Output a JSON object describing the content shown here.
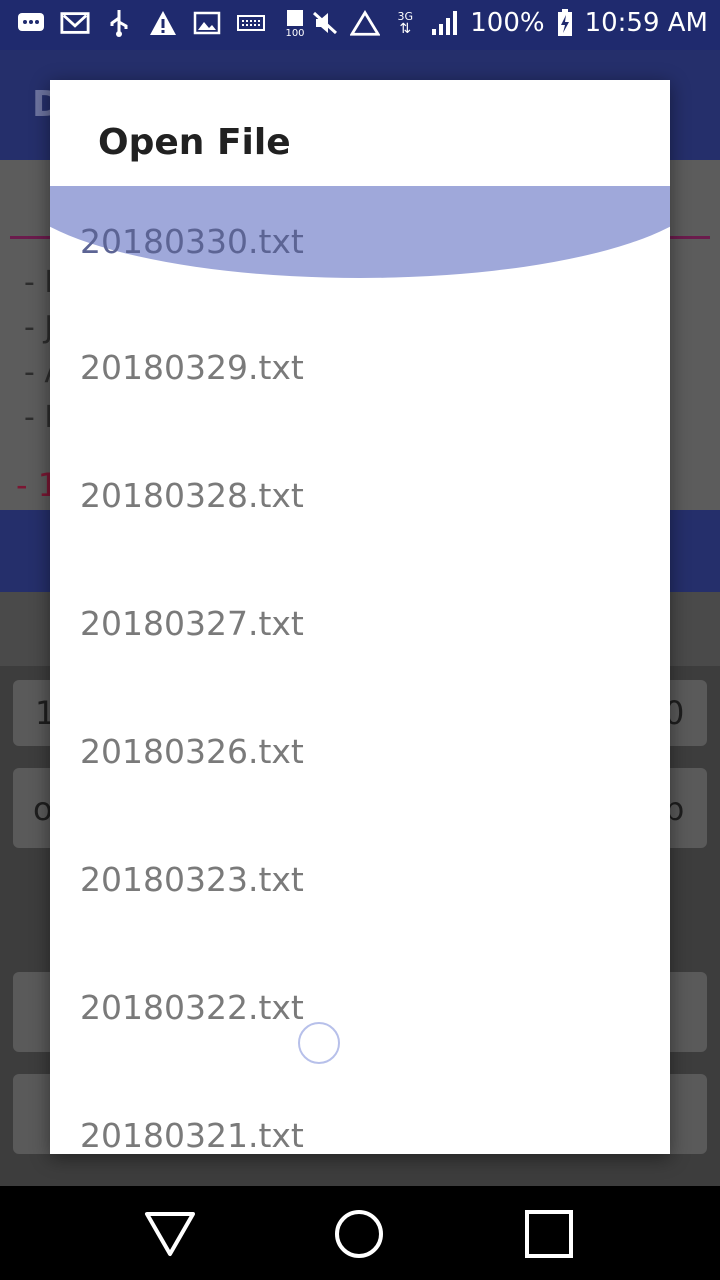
{
  "status_bar": {
    "battery_percent": "100%",
    "time": "10:59 AM",
    "network_type": "3G",
    "icons": [
      "message-icon",
      "gmail-icon",
      "usb-icon",
      "warning-icon",
      "image-icon",
      "keyboard-icon",
      "storage-100-icon",
      "mute-icon",
      "data-saver-icon",
      "network-3g-icon",
      "signal-icon",
      "battery-charging-icon"
    ]
  },
  "background_app": {
    "title_fragment": "D",
    "list_dashes": [
      "- I",
      "- J",
      "- A",
      "- I"
    ],
    "red_fragment": "- 1",
    "key_fragments": {
      "left_top": "1",
      "right_top": "0",
      "left_mid": "o",
      "right_mid": "b"
    }
  },
  "dialog": {
    "title": "Open File",
    "files": [
      {
        "name": "20180330.txt",
        "selected": true
      },
      {
        "name": "20180329.txt"
      },
      {
        "name": "20180328.txt"
      },
      {
        "name": "20180327.txt"
      },
      {
        "name": "20180326.txt"
      },
      {
        "name": "20180323.txt"
      },
      {
        "name": "20180322.txt"
      },
      {
        "name": "20180321.txt"
      }
    ],
    "highlight_color": "#9fa8da"
  },
  "nav_bar": {
    "buttons": [
      "back-triangle-icon",
      "home-circle-icon",
      "recents-square-icon"
    ]
  },
  "colors": {
    "primary_dark": "#1f2a6e",
    "accent_purple": "#6b1c4d"
  }
}
